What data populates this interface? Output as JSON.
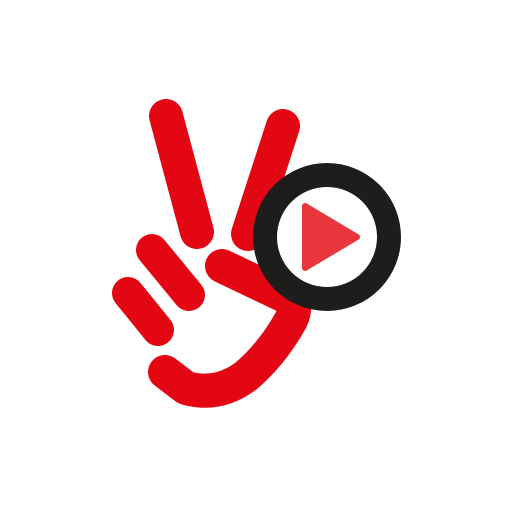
{
  "logo": {
    "icon": "peace-hand-play-logo",
    "colors": {
      "background": "#ffffff",
      "hand": "#e30613",
      "play_ring": "#1d1d1b",
      "play_triangle": "#e8363c"
    }
  }
}
